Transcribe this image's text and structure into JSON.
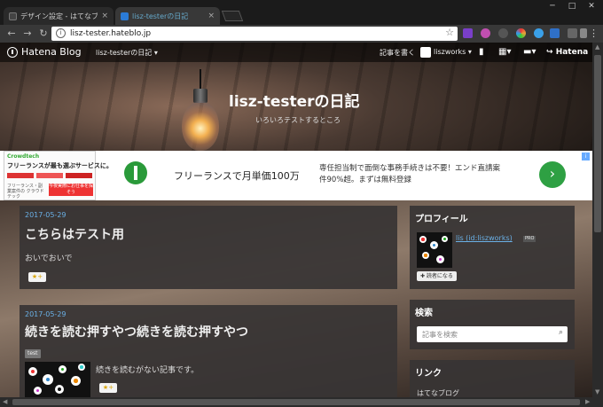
{
  "browser": {
    "tabs": [
      {
        "title": "デザイン設定 - はてなブログ",
        "close": "×",
        "favicon_color": "#444444"
      },
      {
        "title": "lisz-testerの日記",
        "close": "×",
        "favicon_color": "#2b7bd6"
      }
    ],
    "window_controls": [
      "─",
      "□",
      "✕"
    ],
    "address": {
      "url": "lisz-tester.hateblo.jp"
    },
    "nav": {
      "back": "←",
      "forward": "→",
      "reload": "↻"
    },
    "menu": "⋮",
    "extensions": [
      {
        "name": "s-extension-icon",
        "color": "#7a3fc9"
      },
      {
        "name": "p-extension-icon",
        "color": "#c04fb0"
      },
      {
        "name": "circle-extension-icon",
        "color": "#555555"
      },
      {
        "name": "palette-extension-icon",
        "color": "#e8a23a"
      },
      {
        "name": "wheel-extension-icon",
        "color": "#3aa0e8"
      },
      {
        "name": "grid-extension-icon",
        "color": "#2f70c8"
      },
      {
        "name": "chart-extension-icon",
        "color": "#2f6fc8"
      },
      {
        "name": "camera-extension-icon",
        "color": "#666666"
      },
      {
        "name": "box-extension-icon",
        "color": "#888888"
      }
    ]
  },
  "hatena_bar": {
    "logo": "Hatena Blog",
    "blog_name": "lisz-testerの日記 ▾",
    "write": "記事を書く",
    "user": "liszworks ▾",
    "hatena": "Hatena"
  },
  "header": {
    "title": "lisz-testerの日記",
    "tagline": "いろいろテストするところ"
  },
  "ad": {
    "left": {
      "brand": "Crowdtech",
      "headline": "フリーランスが最も選ぶサービスに。",
      "small": "フリーランス・副業案件の クラウドテック",
      "cta": "今夜実際にお仕事を探そう"
    },
    "headline": "フリーランスで月単価100万",
    "text": "専任担当制で面倒な事務手続きは不要！エンド直請案件90%超。まずは無料登録",
    "arrow": "›",
    "info": "i"
  },
  "entries": [
    {
      "date": "2017-05-29",
      "title": "こちらはテスト用",
      "body": "おいでおいで",
      "star": "★+"
    },
    {
      "date": "2017-05-29",
      "title": "続きを読む押すやつ続きを読む押すやつ",
      "category": "test",
      "body": "続きを読むがない記事です。",
      "star": "★+"
    }
  ],
  "sidebar": {
    "profile": {
      "heading": "プロフィール",
      "name": "lis (id:liszworks)",
      "pro": "PRO",
      "reader_button": "✚ 読者になる"
    },
    "search": {
      "heading": "検索",
      "placeholder": "記事を検索",
      "icon": "⌕"
    },
    "links": {
      "heading": "リンク",
      "first": "はてなブログ"
    }
  }
}
